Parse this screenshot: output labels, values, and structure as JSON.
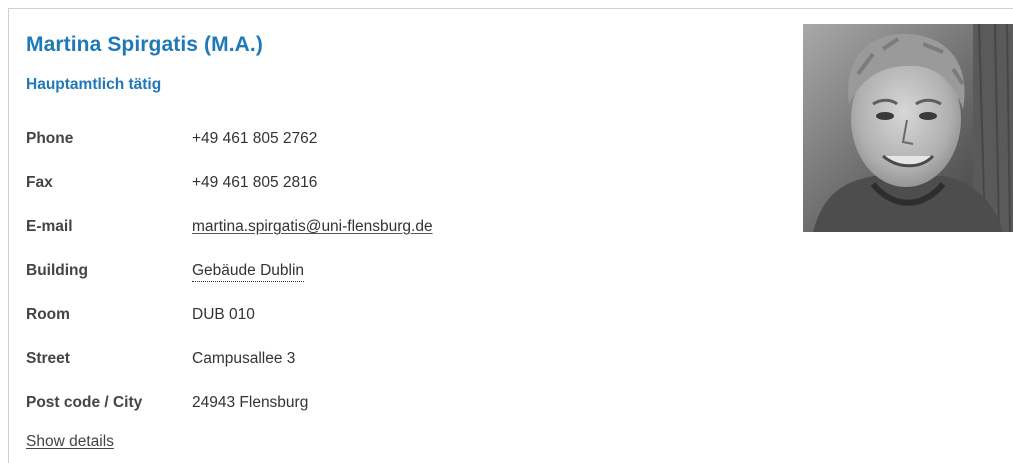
{
  "person": {
    "name": "Martina Spirgatis (M.A.)",
    "role": "Hauptamtlich tätig"
  },
  "contact": [
    {
      "label": "Phone",
      "value": "+49 461 805 2762"
    },
    {
      "label": "Fax",
      "value": "+49 461 805 2816"
    },
    {
      "label": "E-mail",
      "value": "martina.spirgatis@uni-flensburg.de"
    },
    {
      "label": "Building",
      "value": "Gebäude Dublin"
    },
    {
      "label": "Room",
      "value": "DUB 010"
    },
    {
      "label": "Street",
      "value": "Campusallee 3"
    },
    {
      "label": "Post code / City",
      "value": "24943 Flensburg"
    }
  ],
  "details_link": "Show details",
  "colors": {
    "accent": "#1f79b8",
    "text": "#333333",
    "border": "#cfcfcf"
  },
  "photo": {
    "icon": "portrait-photo",
    "style": "grayscale"
  }
}
